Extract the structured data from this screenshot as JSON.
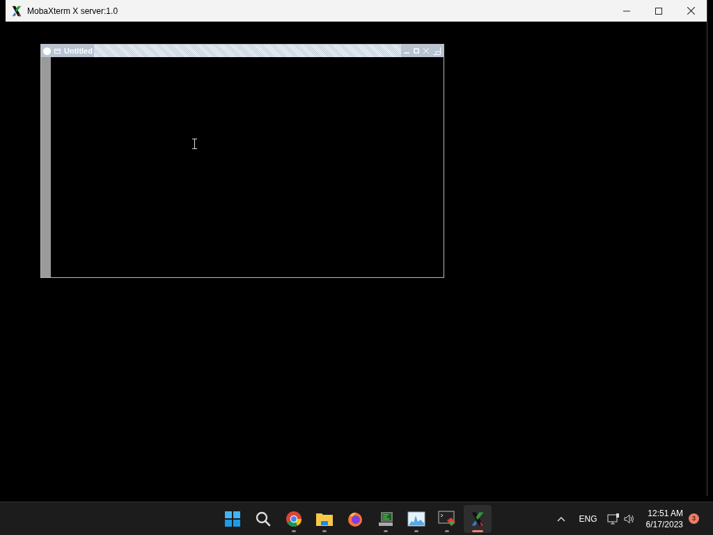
{
  "window": {
    "title": "MobaXterm X server:1.0"
  },
  "x_window": {
    "title": "Untitled"
  },
  "taskbar": {
    "apps": [
      {
        "kind": "start",
        "running": false,
        "selected": false
      },
      {
        "kind": "search",
        "running": false,
        "selected": false
      },
      {
        "kind": "chrome",
        "running": true,
        "selected": false
      },
      {
        "kind": "folder",
        "running": true,
        "selected": false
      },
      {
        "kind": "firefox",
        "running": false,
        "selected": false
      },
      {
        "kind": "monitor",
        "running": true,
        "selected": false
      },
      {
        "kind": "graph",
        "running": true,
        "selected": false
      },
      {
        "kind": "terminal",
        "running": true,
        "selected": false
      },
      {
        "kind": "xserver",
        "running": true,
        "selected": true
      }
    ],
    "language": "ENG",
    "time": "12:51 AM",
    "date": "6/17/2023",
    "badge": "3"
  }
}
